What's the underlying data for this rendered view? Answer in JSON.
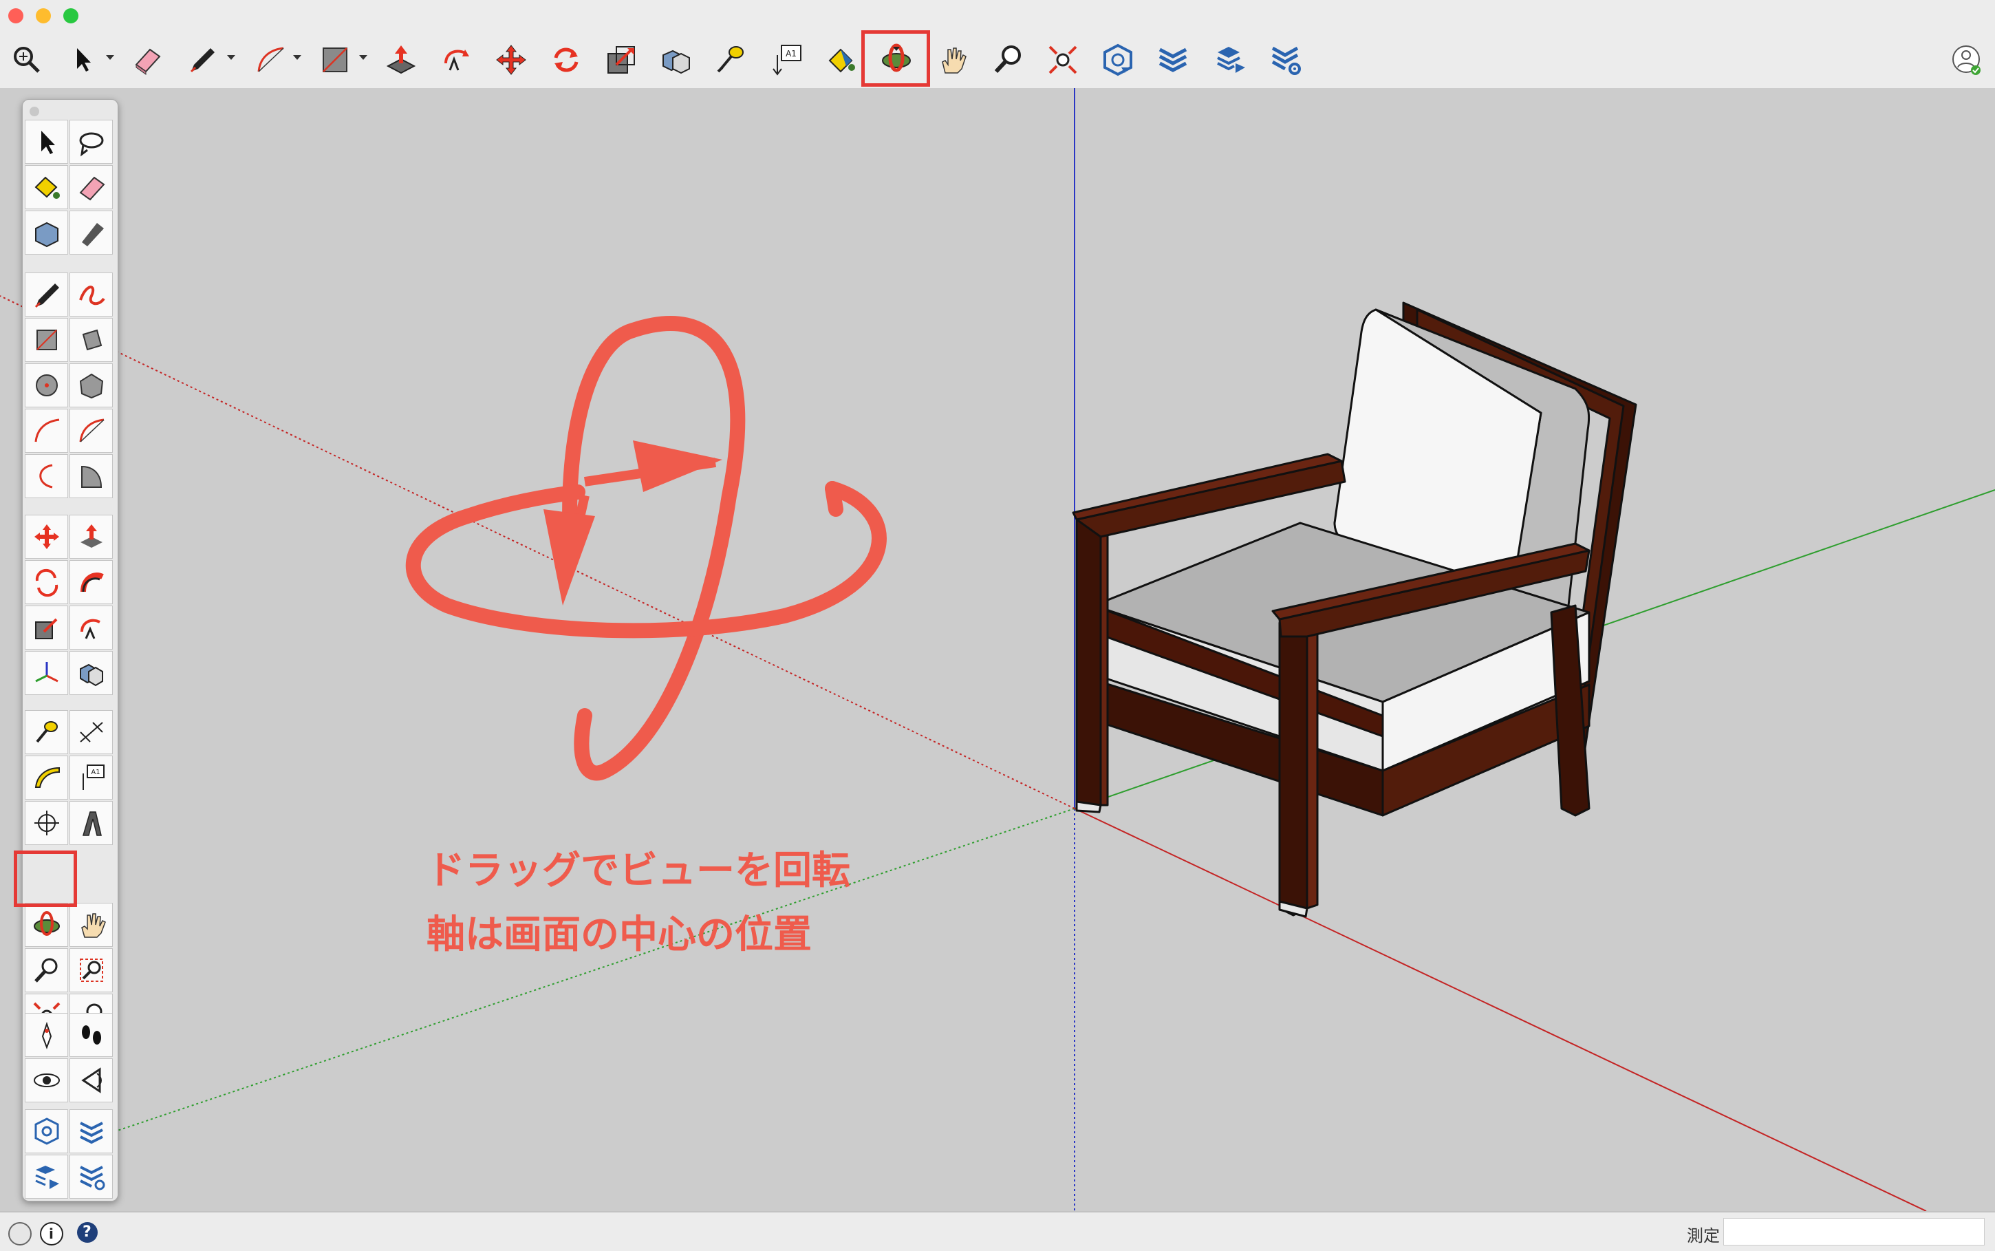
{
  "window": {
    "traffic_colors": [
      "#ff5f57",
      "#febc2e",
      "#28c840"
    ]
  },
  "toolbar": {
    "tools": [
      {
        "name": "search-tool",
        "icon": "magnifier-icon"
      },
      {
        "name": "select-tool",
        "icon": "arrow-icon",
        "dropdown": true
      },
      {
        "name": "eraser-tool",
        "icon": "eraser-icon"
      },
      {
        "name": "line-tool",
        "icon": "pencil-icon",
        "dropdown": true
      },
      {
        "name": "arc-tool",
        "icon": "arc-icon",
        "dropdown": true
      },
      {
        "name": "rectangle-tool",
        "icon": "rectangle-icon",
        "dropdown": true
      },
      {
        "name": "push-pull-tool",
        "icon": "push-pull-icon"
      },
      {
        "name": "offset-tool",
        "icon": "offset-icon"
      },
      {
        "name": "move-tool",
        "icon": "move-icon"
      },
      {
        "name": "rotate-tool",
        "icon": "rotate-icon"
      },
      {
        "name": "scale-tool",
        "icon": "scale-icon"
      },
      {
        "name": "solid-tools",
        "icon": "solid-icon"
      },
      {
        "name": "tape-measure-tool",
        "icon": "tape-icon"
      },
      {
        "name": "text-tool",
        "icon": "text-icon",
        "label": "A1"
      },
      {
        "name": "paint-bucket-tool",
        "icon": "bucket-icon"
      },
      {
        "name": "orbit-tool",
        "icon": "orbit-icon",
        "highlighted": true
      },
      {
        "name": "pan-tool",
        "icon": "hand-icon"
      },
      {
        "name": "zoom-tool",
        "icon": "zoom-icon"
      },
      {
        "name": "zoom-extents-tool",
        "icon": "zoom-extents-icon"
      },
      {
        "name": "3d-warehouse-tool",
        "icon": "warehouse-icon"
      },
      {
        "name": "extension-warehouse-tool",
        "icon": "extension-icon"
      },
      {
        "name": "share-model-tool",
        "icon": "share-icon"
      },
      {
        "name": "extension-manager-tool",
        "icon": "extension-manager-icon"
      }
    ],
    "account_icon": "account-icon"
  },
  "palette": {
    "rows": [
      [
        "select",
        "lasso"
      ],
      [
        "paint",
        "eraser"
      ],
      [
        "component",
        "tag"
      ],
      [
        "line",
        "freehand"
      ],
      [
        "rectangle",
        "rotated-rectangle"
      ],
      [
        "circle",
        "polygon"
      ],
      [
        "arc",
        "2-point-arc"
      ],
      [
        "3-point-arc",
        "pie"
      ],
      [
        "move",
        "push-pull"
      ],
      [
        "rotate",
        "follow-me"
      ],
      [
        "scale",
        "offset"
      ],
      [
        "axes",
        "solid"
      ],
      [
        "tape-measure",
        "dimension"
      ],
      [
        "protractor",
        "text"
      ],
      [
        "section-plane",
        "3d-text"
      ],
      [
        "orbit",
        "pan"
      ],
      [
        "zoom",
        "zoom-window"
      ],
      [
        "zoom-extents",
        "previous-view"
      ],
      [
        "position-camera",
        "walk"
      ],
      [
        "look-around",
        "look"
      ],
      [
        "warehouse",
        "extension-warehouse"
      ],
      [
        "share-model",
        "extension-manager"
      ]
    ],
    "highlighted": "orbit"
  },
  "annotation": {
    "line1": "ドラッグでビューを回転",
    "line2": "軸は画面の中心の位置",
    "color": "#ef5b4c"
  },
  "status": {
    "icons": [
      "geo-location-icon",
      "info-icon",
      "help-icon"
    ],
    "measure_label": "測定",
    "measure_value": ""
  }
}
